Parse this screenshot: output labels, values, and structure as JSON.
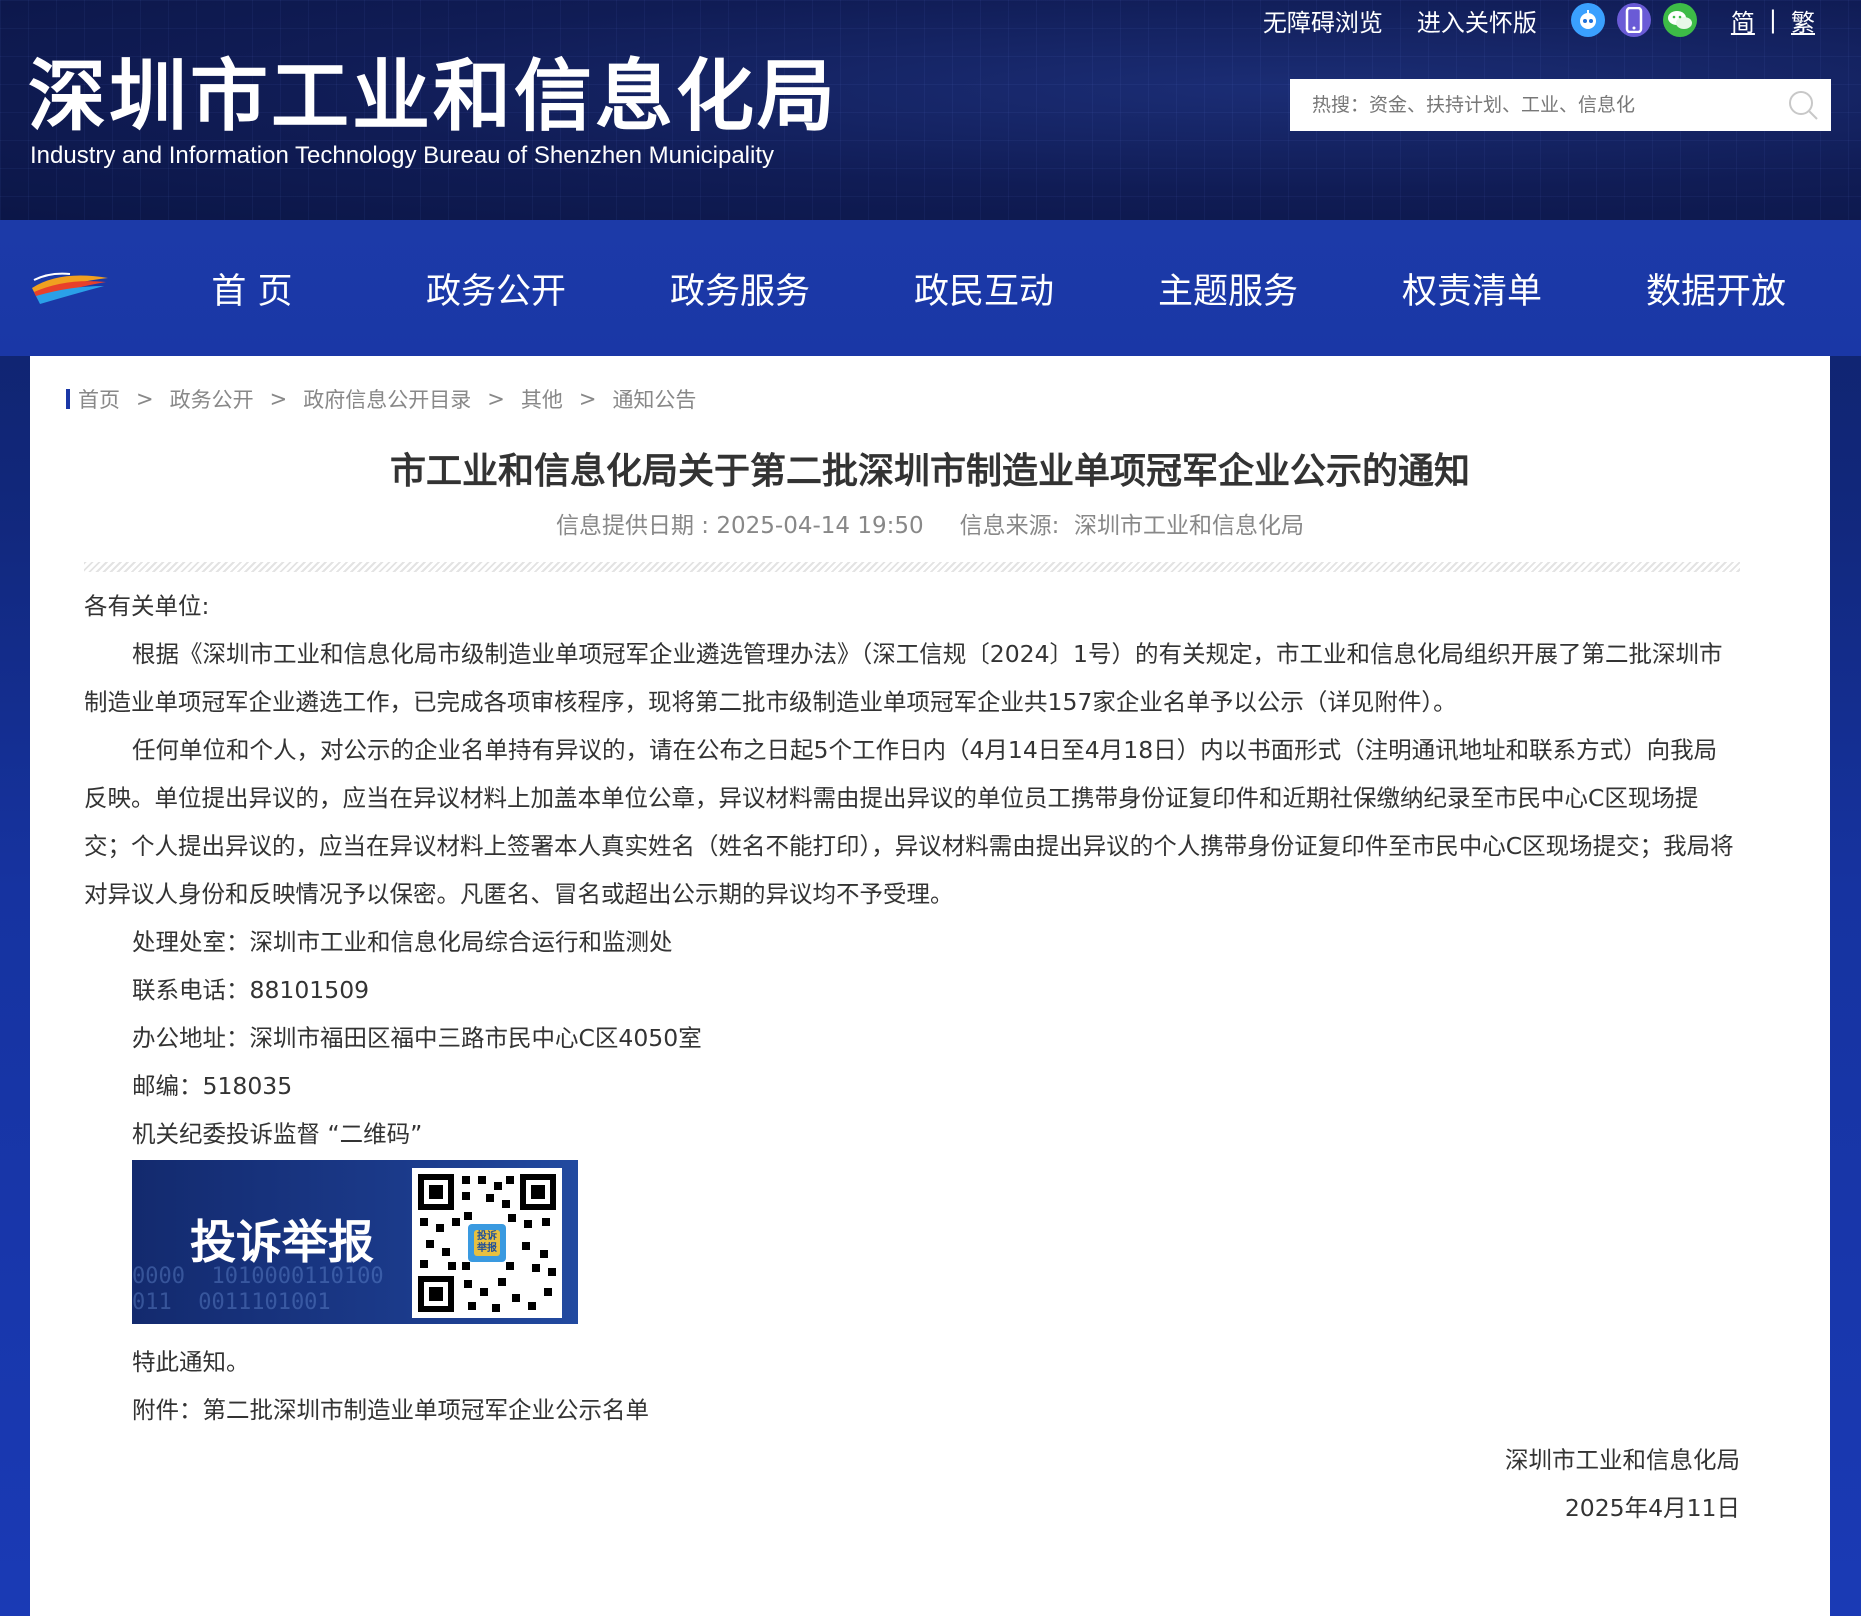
{
  "header": {
    "site_title": "深圳市工业和信息化局",
    "site_subtitle": "Industry and Information Technology Bureau of Shenzhen Municipality",
    "top_links": {
      "accessibility": "无障碍浏览",
      "elder_mode": "进入关怀版",
      "simplified": "简",
      "separator": "|",
      "traditional": "繁"
    },
    "icons": [
      "robot-icon",
      "mobile-icon",
      "wechat-icon",
      "search-icon"
    ],
    "search": {
      "placeholder": "热搜：资金、扶持计划、工业、信息化"
    }
  },
  "nav": {
    "items": [
      "首 页",
      "政务公开",
      "政务服务",
      "政民互动",
      "主题服务",
      "权责清单",
      "数据开放"
    ]
  },
  "breadcrumb": [
    "首页",
    "政务公开",
    "政府信息公开目录",
    "其他",
    "通知公告"
  ],
  "breadcrumb_sep": ">",
  "article": {
    "title": "市工业和信息化局关于第二批深圳市制造业单项冠军企业公示的通知",
    "date_label": "信息提供日期 : 2025-04-14 19:50",
    "source_label": "信息来源:",
    "source": "深圳市工业和信息化局",
    "salutation": "各有关单位:",
    "para1": "根据《深圳市工业和信息化局市级制造业单项冠军企业遴选管理办法》（深工信规〔2024〕1号）的有关规定，市工业和信息化局组织开展了第二批深圳市制造业单项冠军企业遴选工作，已完成各项审核程序，现将第二批市级制造业单项冠军企业共157家企业名单予以公示（详见附件）。",
    "para2": "任何单位和个人，对公示的企业名单持有异议的，请在公布之日起5个工作日内（4月14日至4月18日）内以书面形式（注明通讯地址和联系方式）向我局反映。单位提出异议的，应当在异议材料上加盖本单位公章，异议材料需由提出异议的单位员工携带身份证复印件和近期社保缴纳纪录至市民中心C区现场提交；个人提出异议的，应当在异议材料上签署本人真实姓名（姓名不能打印），异议材料需由提出异议的个人携带身份证复印件至市民中心C区现场提交；我局将对异议人身份和反映情况予以保密。凡匿名、冒名或超出公示期的异议均不予受理。",
    "office": "处理处室：深圳市工业和信息化局综合运行和监测处",
    "phone": "联系电话：88101509",
    "address": "办公地址：深圳市福田区福中三路市民中心C区4050室",
    "postcode": "邮编：518035",
    "qr_caption": "机关纪委投诉监督 “二维码”",
    "qr_banner_text": "投诉举报",
    "qr_badge_text": "投诉举报",
    "qr_bits": "0000  1010000110100\n011  0011101001",
    "closing": "特此通知。",
    "attachment": "附件：第二批深圳市制造业单项冠军企业公示名单",
    "signature_org": "深圳市工业和信息化局",
    "signature_date": "2025年4月11日"
  },
  "colors": {
    "header_bg": "#0f1c57",
    "nav_bg": "#1a37a6",
    "panel_bg": "#ffffff",
    "text": "#333333",
    "muted": "#888888"
  }
}
